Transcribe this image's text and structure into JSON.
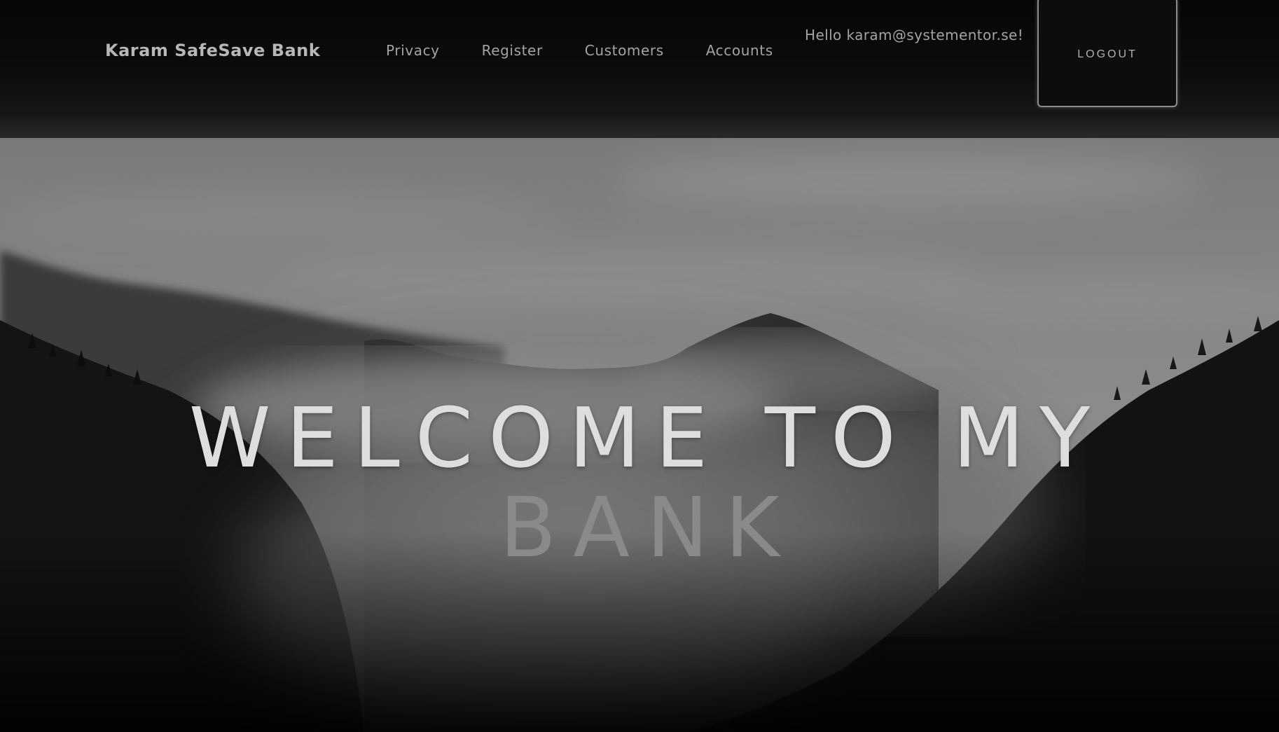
{
  "navbar": {
    "brand": "Karam SafeSave Bank",
    "links": [
      {
        "label": "Privacy"
      },
      {
        "label": "Register"
      },
      {
        "label": "Customers"
      },
      {
        "label": "Accounts"
      }
    ],
    "greeting": "Hello karam@systementor.se!",
    "logout_label": "LOGOUT"
  },
  "hero": {
    "title_line1": "WELCOME TO MY",
    "title_line2": "BANK"
  },
  "colors": {
    "navbar_bg": "#0c0c0c",
    "nav_text": "#a3a3a3",
    "brand_text": "#b7b7b7",
    "hero_title": "#dedede"
  }
}
